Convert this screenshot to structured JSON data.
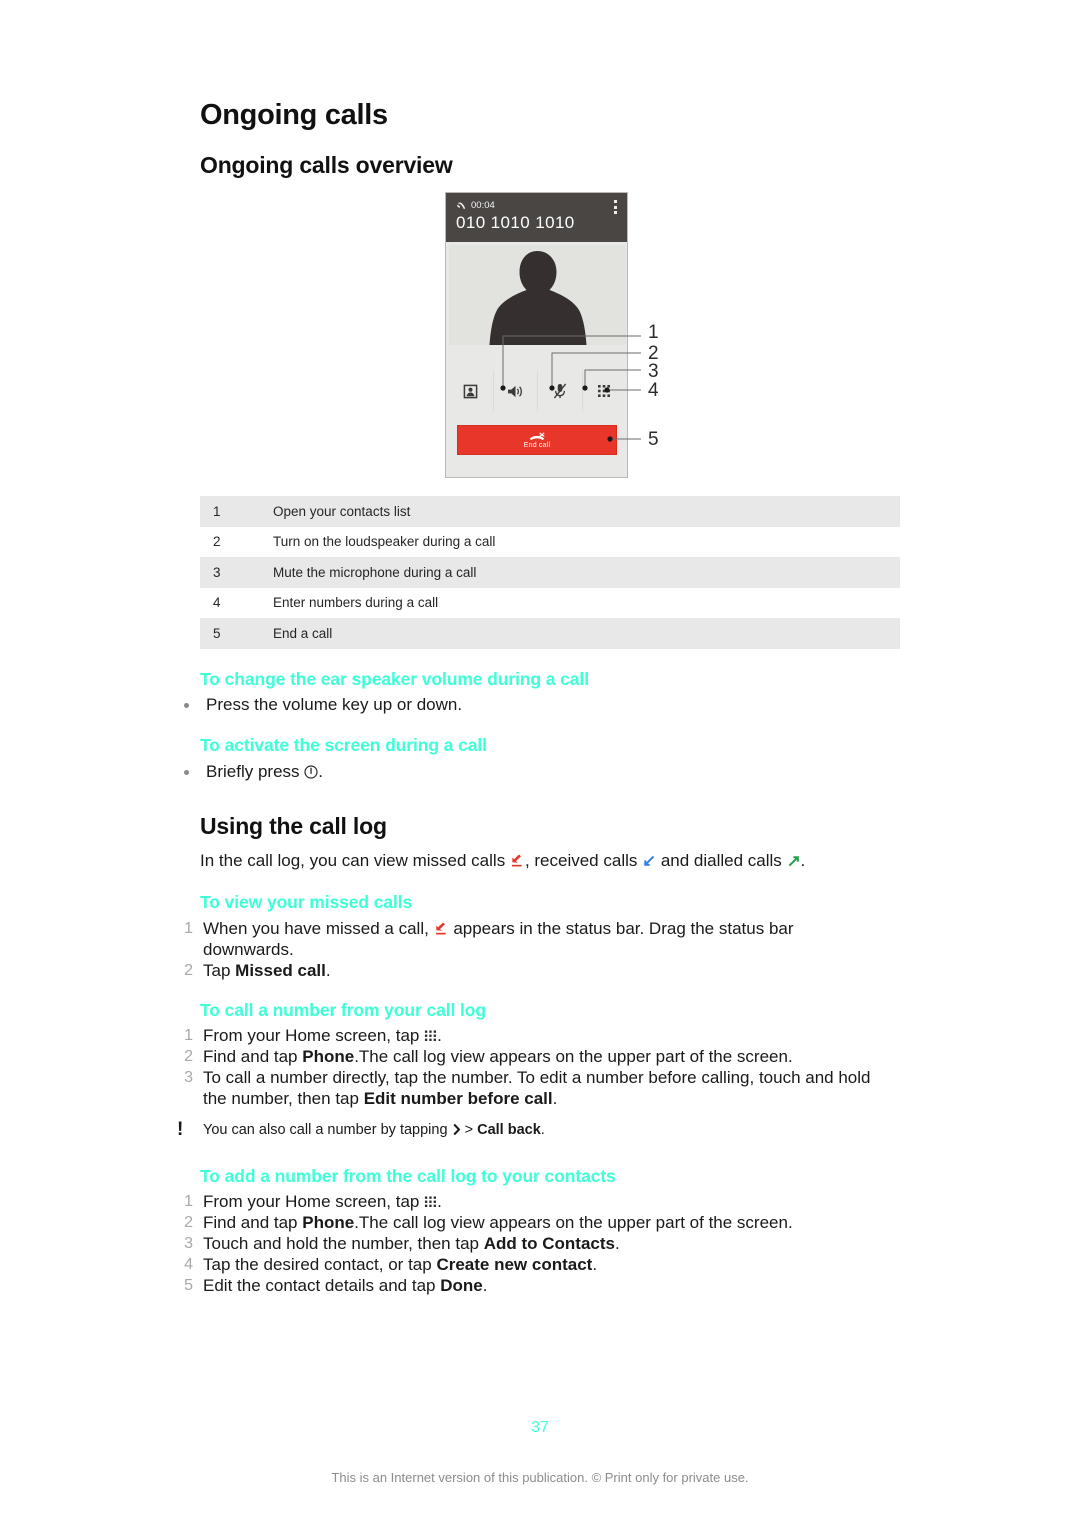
{
  "document": {
    "chapter_title": "Ongoing calls",
    "overview_heading": "Ongoing calls overview",
    "page_number": "37",
    "footer_note": "This is an Internet version of this publication. © Print only for private use."
  },
  "colors": {
    "heading_accent": "#3dffd8",
    "end_call_button": "#e8372a",
    "status_bar": "#4a4644",
    "missed_call_arrow": "#e8372a",
    "received_call_arrow": "#2f7fe8",
    "dialled_call_arrow": "#22a04a",
    "table_row_shade": "#e8e8e8"
  },
  "phone_figure": {
    "status_bar": {
      "call_icon": "phone-handset-icon",
      "timer": "00:04",
      "phone_number": "010 1010 1010",
      "overflow_icon": "more-vertical-icon"
    },
    "avatar": "contact-silhouette-icon",
    "actions": [
      {
        "icon": "contacts-icon",
        "callout": "1"
      },
      {
        "icon": "loudspeaker-icon",
        "callout": "2"
      },
      {
        "icon": "mute-microphone-icon",
        "callout": "3"
      },
      {
        "icon": "dialpad-icon",
        "callout": "4"
      }
    ],
    "end_call": {
      "icon": "end-call-icon",
      "label": "End call",
      "callout": "5"
    },
    "callout_numbers": [
      "1",
      "2",
      "3",
      "4",
      "5"
    ]
  },
  "reference_table": {
    "rows": [
      {
        "num": "1",
        "desc": "Open your contacts list"
      },
      {
        "num": "2",
        "desc": "Turn on the loudspeaker during a call"
      },
      {
        "num": "3",
        "desc": "Mute the microphone during a call"
      },
      {
        "num": "4",
        "desc": "Enter numbers during a call"
      },
      {
        "num": "5",
        "desc": "End a call"
      }
    ]
  },
  "procedures": {
    "ear_speaker_volume": {
      "heading": "To change the ear speaker volume during a call",
      "bullet": "Press the volume key up or down."
    },
    "activate_screen": {
      "heading": "To activate the screen during a call",
      "bullet_before": "Briefly press",
      "bullet_icon": "power-button-icon",
      "bullet_after": "."
    }
  },
  "call_log_section": {
    "heading": "Using the call log",
    "intro": {
      "part1": "In the call log, you can view missed calls",
      "part2": ", received calls",
      "part3": "and dialled calls",
      "part4": "."
    },
    "view_missed": {
      "heading": "To view your missed calls",
      "steps": [
        {
          "num": "1",
          "text_before": "When you have missed a call,",
          "icon": "missed-call-arrow-icon",
          "text_after": "appears in the status bar. Drag the status bar downwards."
        },
        {
          "num": "2",
          "text_before": "Tap",
          "bold": "Missed call",
          "text_after": "."
        }
      ]
    },
    "call_number": {
      "heading": "To call a number from your call log",
      "steps": [
        {
          "num": "1",
          "text_before": "From your Home screen, tap",
          "icon": "app-drawer-grid-icon",
          "text_after": "."
        },
        {
          "num": "2",
          "text_before": "Find and tap",
          "bold": "Phone",
          "text_after": ".The call log view appears on the upper part of the screen."
        },
        {
          "num": "3",
          "text_before": "To call a number directly, tap the number. To edit a number before calling, touch and hold the number, then tap",
          "bold": "Edit number before call",
          "text_after": "."
        }
      ],
      "tip": {
        "marker": "!",
        "text_before": "You can also call a number by tapping",
        "icon": "chevron-right-icon",
        "separator": ">",
        "bold": "Call back",
        "text_after": "."
      }
    },
    "add_number": {
      "heading": "To add a number from the call log to your contacts",
      "steps": [
        {
          "num": "1",
          "text_before": "From your Home screen, tap",
          "icon": "app-drawer-grid-icon",
          "text_after": "."
        },
        {
          "num": "2",
          "text_before": "Find and tap",
          "bold": "Phone",
          "text_after": ".The call log view appears on the upper part of the screen."
        },
        {
          "num": "3",
          "text_before": "Touch and hold the number, then tap",
          "bold": "Add to Contacts",
          "text_after": "."
        },
        {
          "num": "4",
          "text_before": "Tap the desired contact, or tap",
          "bold": "Create new contact",
          "text_after": "."
        },
        {
          "num": "5",
          "text_before": "Edit the contact details and tap",
          "bold": "Done",
          "text_after": "."
        }
      ]
    }
  }
}
